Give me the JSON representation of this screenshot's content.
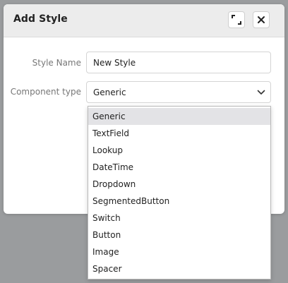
{
  "dialog": {
    "title": "Add Style",
    "maximize_icon": "maximize-icon",
    "close_icon": "close-icon"
  },
  "form": {
    "style_name_label": "Style Name",
    "style_name_value": "New Style",
    "component_type_label": "Component type",
    "component_type_value": "Generic",
    "chevron_icon": "chevron-down-icon"
  },
  "dropdown": {
    "selected_index": 0,
    "options": [
      "Generic",
      "TextField",
      "Lookup",
      "DateTime",
      "Dropdown",
      "SegmentedButton",
      "Switch",
      "Button",
      "Image",
      "Spacer"
    ]
  },
  "colors": {
    "header_bg": "#ececec",
    "backdrop": "#9a9c9e",
    "selected_option_bg": "#e3e3e6"
  }
}
